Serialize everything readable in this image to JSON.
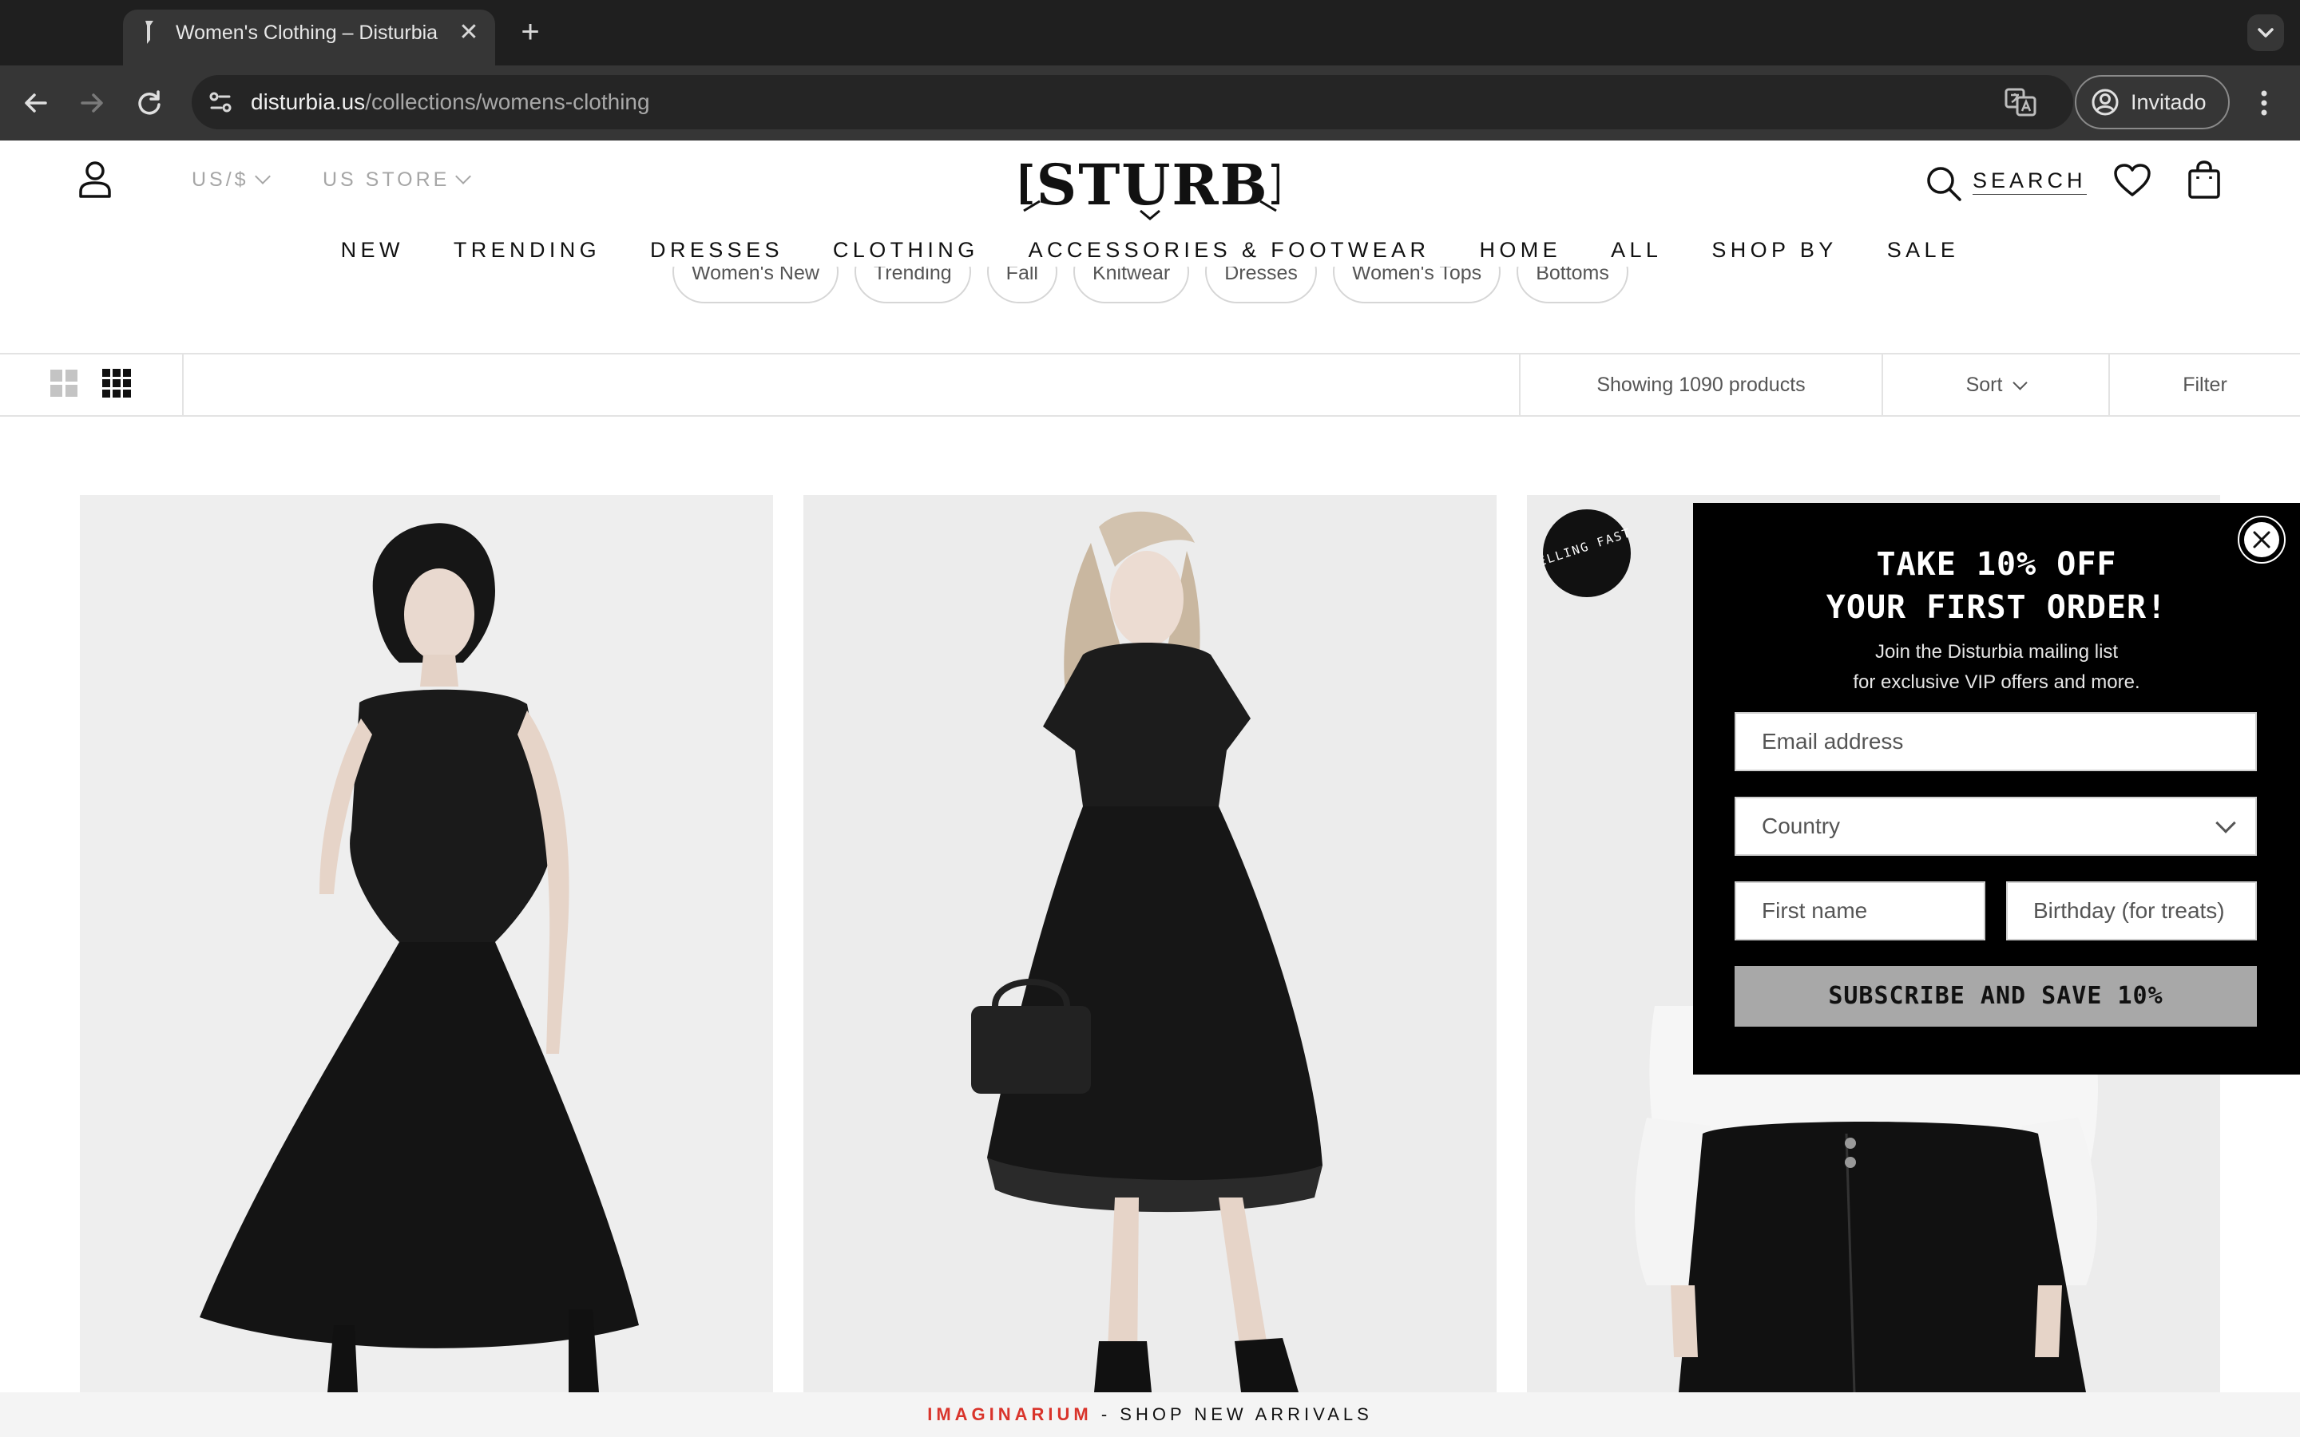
{
  "browser": {
    "tab_title": "Women's Clothing – Disturbia",
    "tab_close": "✕",
    "new_tab": "+",
    "url_host": "disturbia.us",
    "url_path": "/collections/womens-clothing",
    "profile_label": "Invitado"
  },
  "header": {
    "currency": "US/$",
    "store": "US STORE",
    "logo_text": "DISTURBIA",
    "search_label": "SEARCH"
  },
  "nav": {
    "items": [
      "NEW",
      "TRENDING",
      "DRESSES",
      "CLOTHING",
      "ACCESSORIES & FOOTWEAR",
      "HOME",
      "ALL",
      "SHOP BY",
      "SALE"
    ]
  },
  "filters": {
    "pills": [
      "Women's New",
      "Trending",
      "Fall",
      "Knitwear",
      "Dresses",
      "Women's Tops",
      "Bottoms"
    ]
  },
  "collection_toolbar": {
    "count_text": "Showing 1090 products",
    "sort_label": "Sort",
    "filter_label": "Filter"
  },
  "products": {
    "badge_text": "SELLING FAST!"
  },
  "popup": {
    "title_line1": "TAKE 10% OFF",
    "title_line2": "YOUR FIRST ORDER!",
    "subtitle_line1": "Join the Disturbia mailing list",
    "subtitle_line2": "for exclusive VIP offers and more.",
    "email_placeholder": "Email address",
    "country_placeholder": "Country",
    "first_name_placeholder": "First name",
    "birthday_placeholder": "Birthday (for treats)",
    "subscribe_label": "SUBSCRIBE AND SAVE 10%"
  },
  "announcement": {
    "highlight": "IMAGINARIUM",
    "text": " - SHOP NEW ARRIVALS"
  },
  "colors": {
    "chrome_dark": "#1f1f1f",
    "chrome_toolbar": "#363636",
    "popup_bg": "#000000",
    "subscribe_bg": "#a8a8a8",
    "announcement_accent": "#d9342b"
  }
}
